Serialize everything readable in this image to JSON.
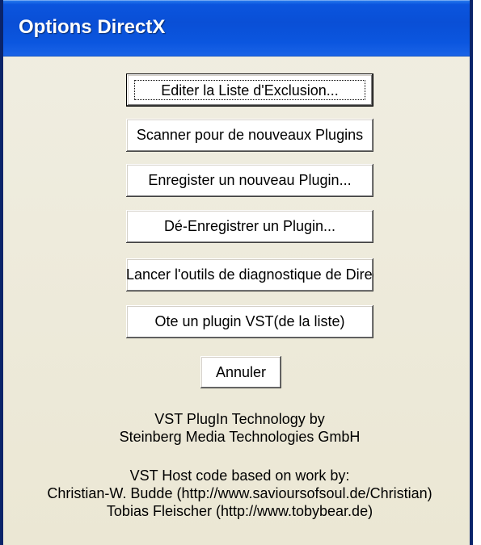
{
  "window": {
    "title": "Options DirectX"
  },
  "buttons": {
    "edit_exclusion_list": "Editer la Liste d'Exclusion...",
    "scan_new_plugins": "Scanner pour de nouveaux Plugins",
    "register_new_plugin": "Enregister un nouveau Plugin...",
    "unregister_plugin": "Dé-Enregistrer un Plugin...",
    "launch_diagnostic_tool": "Lancer l'outils de diagnostique de DirectX",
    "remove_vst_plugin": "Ote un plugin VST(de la liste)",
    "cancel": "Annuler"
  },
  "credits": {
    "vst_technology_line1": "VST PlugIn Technology by",
    "vst_technology_line2": "Steinberg Media Technologies GmbH",
    "host_code_line1": "VST Host code based on work by:",
    "host_code_line2": "Christian-W. Budde (http://www.savioursofsoul.de/Christian)",
    "host_code_line3": "Tobias Fleischer (http://www.tobybear.de)"
  },
  "colors": {
    "title_bar": "#0a4fd6",
    "window_border": "#0a246a",
    "dialog_background": "#ebe7d4",
    "button_background": "#ffffff"
  }
}
